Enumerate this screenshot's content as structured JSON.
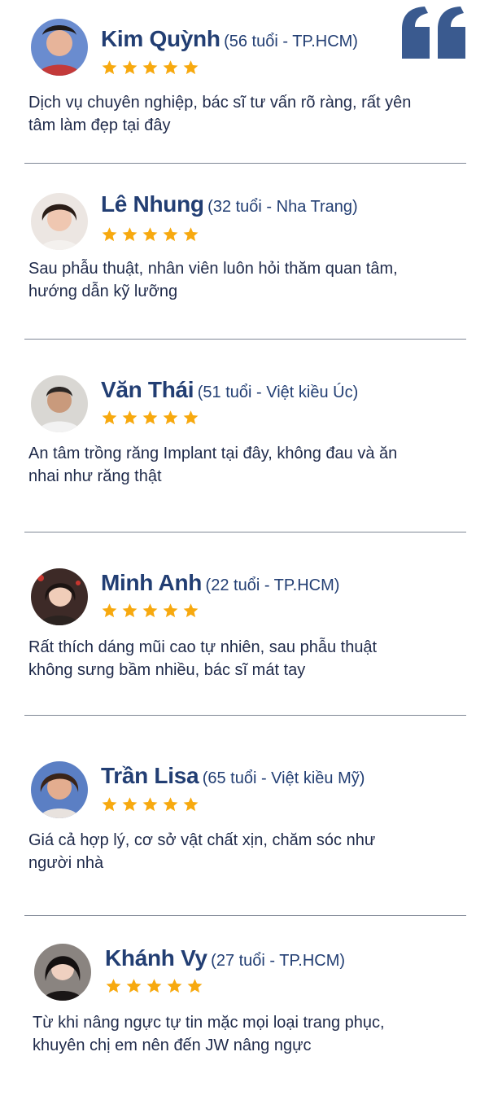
{
  "colors": {
    "name": "#223e73",
    "star": "#f7a90f",
    "quote": "#3a5a8f",
    "divider": "#7f8795"
  },
  "icons": {
    "quote": "quote-icon",
    "star": "star-icon"
  },
  "rating_stars": 5,
  "reviews": [
    {
      "name": "Kim Quỳnh",
      "meta": "(56 tuổi - TP.HCM)",
      "rating": 5,
      "line1": "Dịch vụ chuyên nghiệp, bác sĩ tư vấn rõ ràng, rất yên",
      "line2": "tâm làm đẹp tại đây"
    },
    {
      "name": "Lê Nhung",
      "meta": "(32 tuổi - Nha Trang)",
      "rating": 5,
      "line1": "Sau phẫu thuật, nhân viên luôn hỏi thăm quan tâm,",
      "line2": "hướng dẫn kỹ lưỡng"
    },
    {
      "name": "Văn Thái",
      "meta": "(51 tuổi - Việt kiều Úc)",
      "rating": 5,
      "line1": "An tâm trồng răng Implant tại đây, không đau và ăn",
      "line2": "nhai như răng thật"
    },
    {
      "name": "Minh Anh",
      "meta": "(22 tuổi - TP.HCM)",
      "rating": 5,
      "line1": "Rất thích dáng mũi cao tự nhiên, sau phẫu thuật",
      "line2": "không sưng bầm nhiều, bác sĩ mát tay"
    },
    {
      "name": "Trần Lisa",
      "meta": "(65 tuổi - Việt kiều Mỹ)",
      "rating": 5,
      "line1": "Giá cả hợp lý, cơ sở vật chất xịn, chăm sóc như",
      "line2": "người nhà"
    },
    {
      "name": "Khánh Vy",
      "meta": "(27 tuổi - TP.HCM)",
      "rating": 5,
      "line1": "Từ khi nâng ngực tự tin mặc mọi loại trang phục,",
      "line2": "khuyên chị em nên đến JW nâng ngực"
    }
  ]
}
